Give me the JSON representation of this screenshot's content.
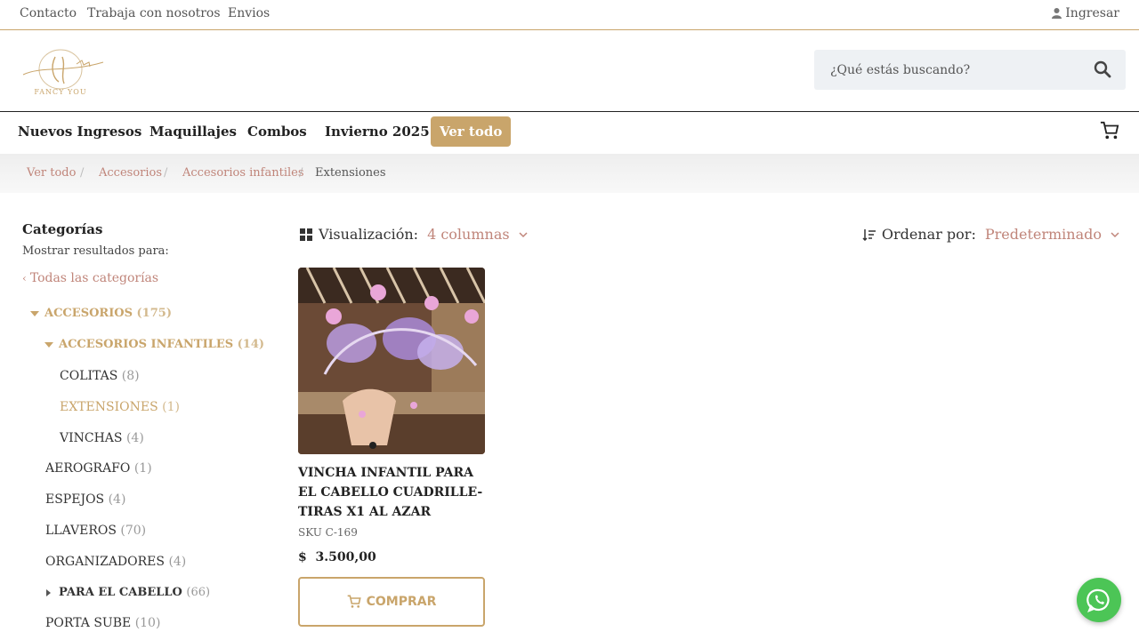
{
  "topbar": {
    "links": [
      "Contacto",
      "Trabaja con nosotros",
      "Envios"
    ],
    "login": "Ingresar"
  },
  "header": {
    "logo_text": "FANCY YOU",
    "search_placeholder": "¿Qué estás buscando?"
  },
  "nav": {
    "items": [
      "Nuevos Ingresos",
      "Maquillajes",
      "Combos",
      "Invierno 2025"
    ],
    "cta": "Ver todo"
  },
  "breadcrumb": [
    "Ver todo",
    "Accesorios",
    "Accesorios infantiles",
    "Extensiones"
  ],
  "sidebar": {
    "title": "Categorías",
    "subtitle": "Mostrar resultados para:",
    "all_categories": "Todas las categorías",
    "categories": [
      {
        "label": "ACCESORIOS",
        "count": "(175)"
      },
      {
        "label": "ACCESORIOS INFANTILES",
        "count": "(14)"
      },
      {
        "label": "COLITAS",
        "count": "(8)"
      },
      {
        "label": "EXTENSIONES",
        "count": "(1)"
      },
      {
        "label": "VINCHAS",
        "count": "(4)"
      },
      {
        "label": "AEROGRAFO",
        "count": "(1)"
      },
      {
        "label": "ESPEJOS",
        "count": "(4)"
      },
      {
        "label": "LLAVEROS",
        "count": "(70)"
      },
      {
        "label": "ORGANIZADORES",
        "count": "(4)"
      },
      {
        "label": "PARA EL CABELLO",
        "count": "(66)"
      },
      {
        "label": "PORTA SUBE",
        "count": "(10)"
      }
    ]
  },
  "toolbar": {
    "view_label": "Visualización:",
    "view_value": "4 columnas",
    "sort_label": "Ordenar por:",
    "sort_value": "Predeterminado"
  },
  "product": {
    "title": "VINCHA INFANTIL PARA EL CABELLO CUADRILLE-TIRAS X1 AL AZAR",
    "sku": "SKU C-169",
    "price": "$  3.500,00",
    "buy_label": "COMPRAR"
  },
  "colors": {
    "accent": "#c9a56b",
    "link": "#c0857a",
    "whatsapp": "#4cc556"
  }
}
